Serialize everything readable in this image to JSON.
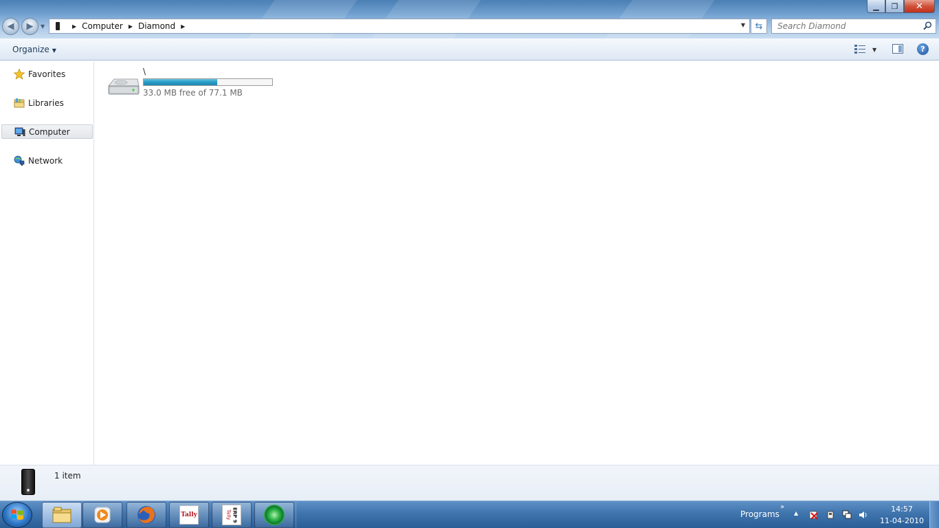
{
  "window": {
    "minimize_glyph": "▁",
    "restore_glyph": "❐",
    "close_glyph": "✕"
  },
  "address_bar": {
    "breadcrumbs": [
      "Computer",
      "Diamond"
    ],
    "search_placeholder": "Search Diamond"
  },
  "toolbar": {
    "organize_label": "Organize"
  },
  "nav_pane": {
    "items": [
      {
        "label": "Favorites",
        "icon": "star-icon"
      },
      {
        "label": "Libraries",
        "icon": "libraries-icon"
      },
      {
        "label": "Computer",
        "icon": "computer-icon",
        "selected": true
      },
      {
        "label": "Network",
        "icon": "network-icon"
      }
    ]
  },
  "content": {
    "drive": {
      "name": "\\",
      "free_text": "33.0 MB free of 77.1 MB",
      "used_fraction": 0.57
    }
  },
  "details": {
    "item_count": "1 item"
  },
  "taskbar": {
    "programs_label": "Programs",
    "time": "14:57",
    "date": "11-04-2010",
    "tally_label": "Tally",
    "tally_erp_label": "ERP 9",
    "tally_erp_brand": "Tally"
  },
  "colors": {
    "bar_fill": "#2a9ec7",
    "title_gradient_top": "#4a7fb5",
    "taskbar": "#3f74ad"
  }
}
